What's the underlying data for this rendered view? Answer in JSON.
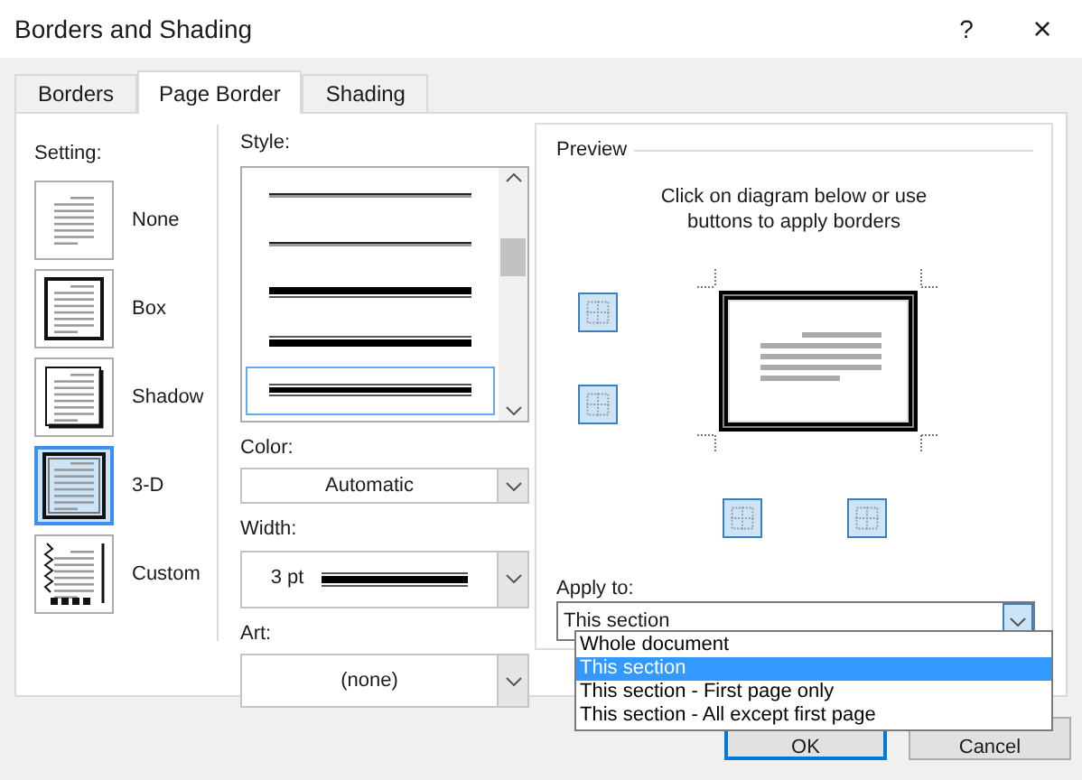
{
  "window": {
    "title": "Borders and Shading",
    "help": "?",
    "close": "×"
  },
  "tabs": [
    {
      "label": "Borders",
      "selected": false
    },
    {
      "label": "Page Border",
      "selected": true
    },
    {
      "label": "Shading",
      "selected": false
    }
  ],
  "setting": {
    "label": "Setting:",
    "items": [
      {
        "label": "None",
        "kind": "none",
        "selected": false
      },
      {
        "label": "Box",
        "kind": "box",
        "selected": false
      },
      {
        "label": "Shadow",
        "kind": "shadow",
        "selected": false
      },
      {
        "label": "3-D",
        "kind": "threed",
        "selected": true
      },
      {
        "label": "Custom",
        "kind": "custom",
        "selected": false
      }
    ]
  },
  "style": {
    "label": "Style:",
    "items": [
      {
        "kind": "thin-gray",
        "selected": false
      },
      {
        "kind": "thin-gray",
        "selected": false
      },
      {
        "kind": "thick-thin",
        "selected": false
      },
      {
        "kind": "thin-thick",
        "selected": false
      },
      {
        "kind": "thin-thick-thin",
        "selected": true
      }
    ]
  },
  "color": {
    "label": "Color:",
    "value": "Automatic"
  },
  "width": {
    "label": "Width:",
    "value": "3 pt"
  },
  "art": {
    "label": "Art:",
    "value": "(none)"
  },
  "preview": {
    "label": "Preview",
    "hint": "Click on diagram below or use buttons to apply borders"
  },
  "apply_to": {
    "label": "Apply to:",
    "value": "This section",
    "expanded": true,
    "options": [
      {
        "label": "Whole document",
        "selected": false
      },
      {
        "label": "This section",
        "selected": true
      },
      {
        "label": "This section - First page only",
        "selected": false
      },
      {
        "label": "This section - All except first page",
        "selected": false
      }
    ]
  },
  "buttons": [
    {
      "label": "OK",
      "default": true
    },
    {
      "label": "Cancel",
      "default": false
    }
  ]
}
